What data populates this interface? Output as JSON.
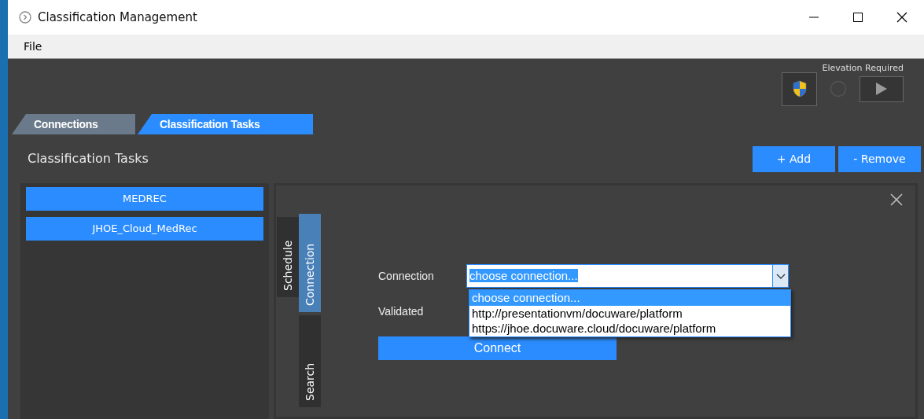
{
  "window": {
    "title": "Classification Management"
  },
  "menu": [
    "File"
  ],
  "elevation": {
    "label": "Elevation Required"
  },
  "main_tabs": [
    {
      "label": "Connections",
      "selected": false
    },
    {
      "label": "Classification Tasks",
      "selected": true
    }
  ],
  "section_title": "Classification Tasks",
  "toolbar_buttons": [
    "+ Add",
    "- Remove"
  ],
  "tasks": [
    {
      "name": "MEDREC"
    },
    {
      "name": "JHOE_Cloud_MedRec"
    }
  ],
  "detail_tabs": [
    {
      "label": "Schedule",
      "selected": false
    },
    {
      "label": "Connection",
      "selected": true
    },
    {
      "label": "Search",
      "selected": false
    }
  ],
  "form": {
    "connection_label": "Connection",
    "connection_value": "choose connection...",
    "options": [
      {
        "label": "choose connection...",
        "selected": true
      },
      {
        "label": "http://presentationvm/docuware/platform",
        "selected": false
      },
      {
        "label": "https://jhoe.docuware.cloud/docuware/platform",
        "selected": false
      }
    ],
    "validated_label": "Validated",
    "connect_button": "Connect"
  }
}
